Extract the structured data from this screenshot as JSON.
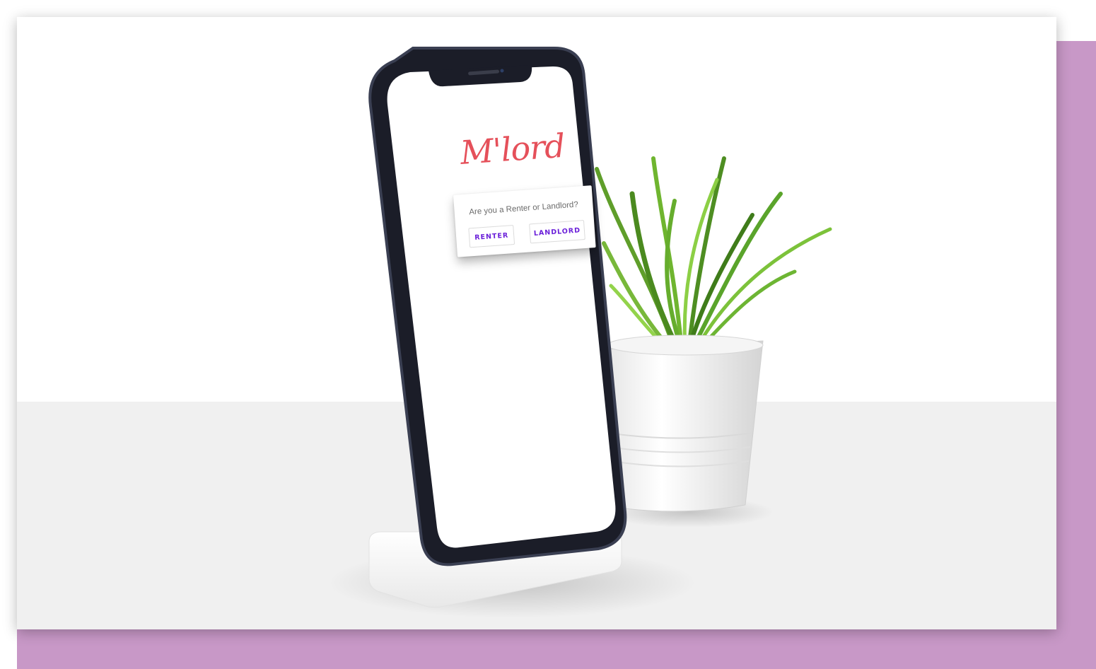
{
  "app": {
    "logo_text": "M'lord"
  },
  "role_prompt": {
    "question": "Are you a Renter or Landlord?",
    "renter_label": "RENTER",
    "landlord_label": "LANDLORD"
  },
  "colors": {
    "backdrop_purple": "#c898c7",
    "logo_red": "#e5505a",
    "button_text_purple": "#6a1fd9",
    "tabletop_gray": "#f0f0f0"
  }
}
